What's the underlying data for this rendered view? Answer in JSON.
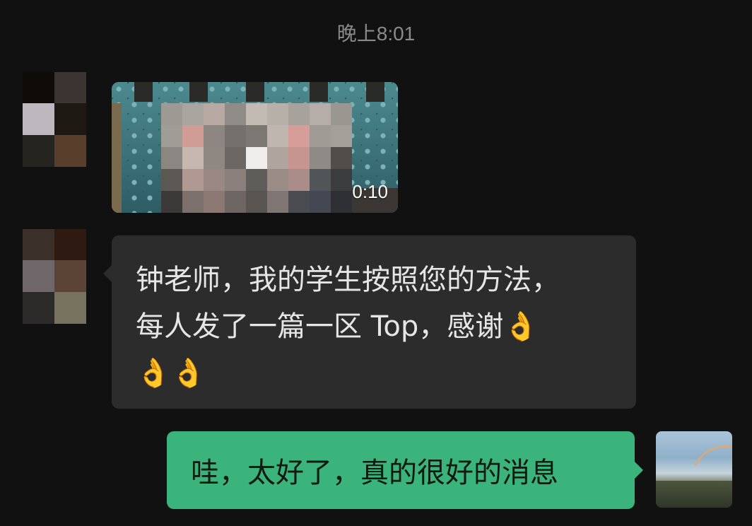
{
  "chat": {
    "timestamp": "晚上8:01",
    "messages": [
      {
        "type": "video",
        "direction": "incoming",
        "duration": "0:10"
      },
      {
        "type": "text",
        "direction": "incoming",
        "lines": [
          "钟老师，我的学生按照您的方法，",
          "每人发了一篇一区 Top，感谢"
        ],
        "emoji": "👌",
        "emoji_icon": "ok-hand-icon",
        "emoji_count": 3
      },
      {
        "type": "text",
        "direction": "outgoing",
        "text": "哇，太好了，真的很好的消息"
      }
    ]
  },
  "colors": {
    "background": "#111111",
    "incoming_bubble": "#2c2c2c",
    "outgoing_bubble": "#3ab47a",
    "timestamp": "#8a8a8a"
  }
}
